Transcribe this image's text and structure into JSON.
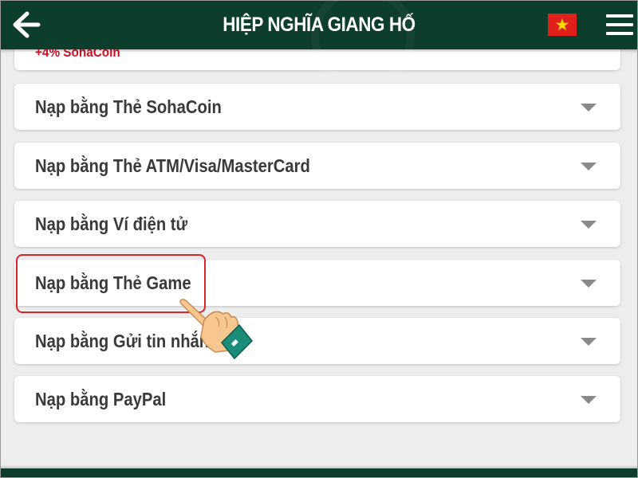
{
  "header": {
    "title": "HIỆP NGHĨA GIANG HỐ",
    "back_icon": "arrow-left-icon",
    "flag_icon": "vietnam-flag-icon",
    "menu_icon": "hamburger-menu-icon"
  },
  "partial_item": {
    "bonus": "+4% SohaCoin"
  },
  "items": [
    {
      "label": "Nạp bằng Thẻ SohaCoin"
    },
    {
      "label": "Nạp bằng Thẻ ATM/Visa/MasterCard"
    },
    {
      "label": "Nạp bằng Ví điện tử"
    },
    {
      "label": "Nạp bằng Thẻ Game"
    },
    {
      "label": "Nạp bằng Gửi tin nhắn"
    },
    {
      "label": "Nạp bằng PayPal"
    }
  ],
  "colors": {
    "header_bg": "#0d3d2b",
    "highlight": "#d9232b",
    "bonus_text": "#d0112b"
  }
}
